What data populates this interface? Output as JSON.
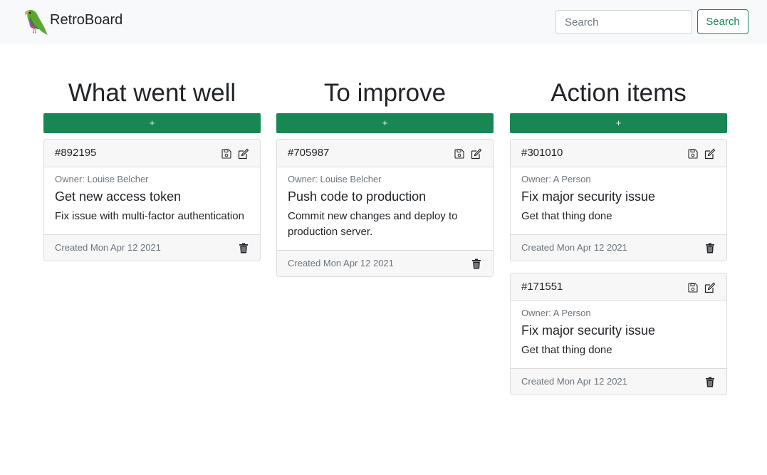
{
  "app": {
    "brand": "RetroBoard",
    "logo_icon": "parrot-logo-icon"
  },
  "search": {
    "placeholder": "Search",
    "value": "",
    "button_label": "Search"
  },
  "colors": {
    "accent": "#198754",
    "navbar_bg": "#f8f9fa",
    "card_header_bg": "#f7f7f7"
  },
  "columns": [
    {
      "title": "What went well",
      "add_label": "+",
      "cards": [
        {
          "id": "#892195",
          "owner": "Owner: Louise Belcher",
          "title": "Get new access token",
          "text": "Fix issue with multi-factor authentication",
          "created": "Created Mon Apr 12 2021"
        }
      ]
    },
    {
      "title": "To improve",
      "add_label": "+",
      "cards": [
        {
          "id": "#705987",
          "owner": "Owner: Louise Belcher",
          "title": "Push code to production",
          "text": "Commit new changes and deploy to production server.",
          "created": "Created Mon Apr 12 2021"
        }
      ]
    },
    {
      "title": "Action items",
      "add_label": "+",
      "cards": [
        {
          "id": "#301010",
          "owner": "Owner: A Person",
          "title": "Fix major security issue",
          "text": "Get that thing done",
          "created": "Created Mon Apr 12 2021"
        },
        {
          "id": "#171551",
          "owner": "Owner: A Person",
          "title": "Fix major security issue",
          "text": "Get that thing done",
          "created": "Created Mon Apr 12 2021"
        }
      ]
    }
  ]
}
